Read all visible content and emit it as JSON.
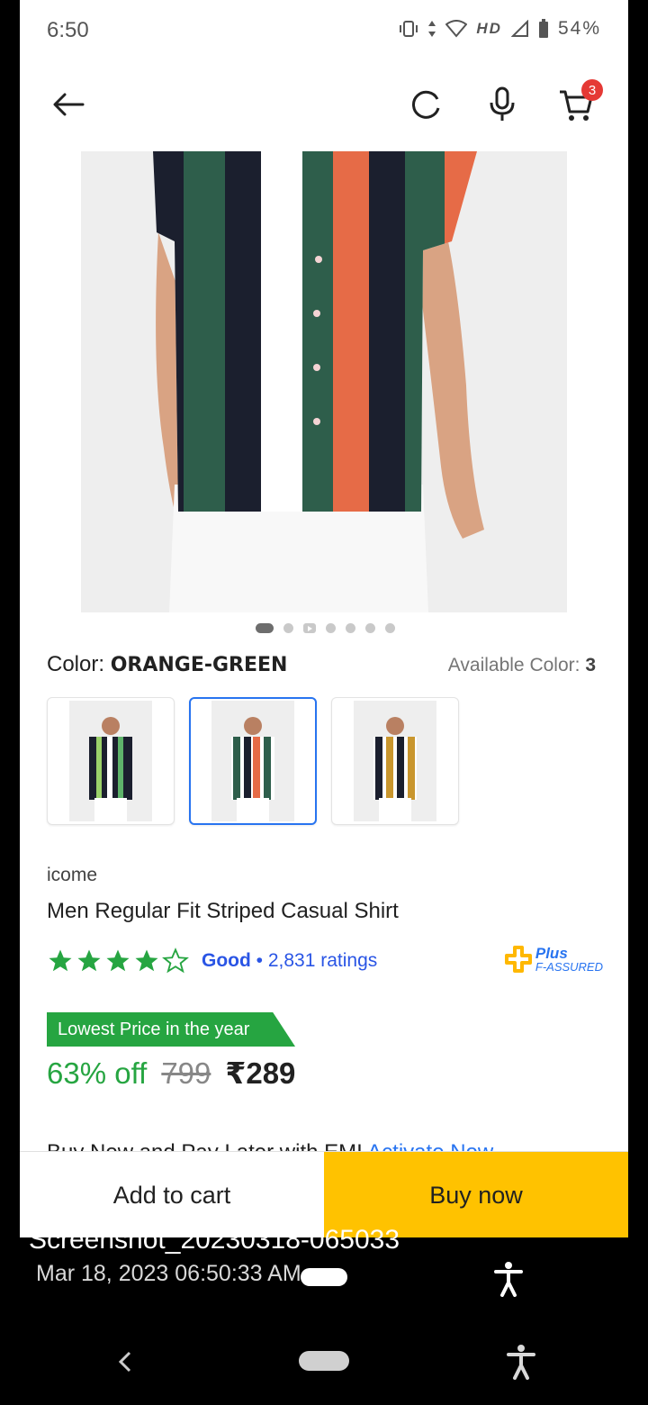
{
  "status_bar": {
    "time": "6:50",
    "icons": [
      "vibrate-icon",
      "data-arrows-icon",
      "wifi-icon",
      "signal-icon",
      "battery-icon"
    ],
    "network": "HD",
    "battery": "54%"
  },
  "app_bar": {
    "cart_count": "3"
  },
  "gallery": {
    "dot_count": 7,
    "active_index": 0
  },
  "color": {
    "label": "Color:",
    "value": "ORANGE-GREEN",
    "available_label": "Available Color:",
    "available_count": "3",
    "variants": [
      "green-stripe",
      "orange-green",
      "yellow-stripe"
    ],
    "selected_index": 1
  },
  "product": {
    "brand": "icome",
    "title": "Men Regular Fit Striped Casual Shirt",
    "rating_stars": 4,
    "rating_word": "Good",
    "ratings": "• 2,831 ratings",
    "plus_title": "Plus",
    "plus_sub": "F-ASSURED"
  },
  "pricing": {
    "tag": "Lowest Price in the year",
    "discount": "63% off",
    "mrp": "799",
    "price": "₹289"
  },
  "partial_text": {
    "text": "Buy Now and Pay Later with EMI",
    "link": "Activate Now"
  },
  "actions": {
    "add_to_cart": "Add to cart",
    "buy_now": "Buy now"
  },
  "overlay": {
    "name": "Screenshot_20230318-065033",
    "date": "Mar 18, 2023 06:50:33 AM"
  },
  "colors": {
    "accent_blue": "#2874f0",
    "offer_green": "#26a541",
    "buy_yellow": "#ffc200",
    "badge_red": "#e53935"
  }
}
